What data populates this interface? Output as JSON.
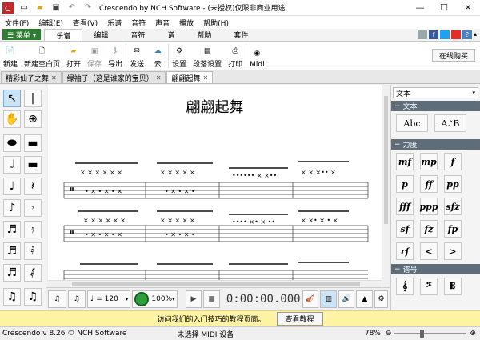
{
  "window": {
    "title": "Crescendo by NCH Software - (未授权)仅限非商业用途"
  },
  "menu": [
    "文件(F)",
    "编辑(E)",
    "查看(V)",
    "乐谱",
    "音符",
    "声音",
    "播放",
    "帮助(H)"
  ],
  "ribbon": {
    "main_button": "☰ 菜单 ▾",
    "tabs": [
      "乐谱",
      "编辑",
      "音符",
      "谱",
      "帮助",
      "套件"
    ]
  },
  "toolbar": {
    "new": "新建",
    "new_blank": "新建空白页",
    "open": "打开",
    "save": "保存",
    "export": "导出",
    "send": "发送",
    "cloud": "云",
    "settings": "设置",
    "staff_settings": "段落设置",
    "print": "打印",
    "midi": "Midi",
    "buy_online": "在线购买"
  },
  "doc_tabs": [
    "精彩仙子之舞",
    "绿袖子（这是谁家的宝贝）",
    "翩翩起舞"
  ],
  "score": {
    "title": "翩翩起舞"
  },
  "playback": {
    "tempo": "= 120",
    "volume": "100%",
    "time": "0:00:00.000"
  },
  "right_panel": {
    "selector": "文本",
    "sections": {
      "text": "文本",
      "dynamics": "力度",
      "clefs": "谱号"
    },
    "dynamics": [
      "mf",
      "mp",
      "f",
      "p",
      "ff",
      "pp",
      "fff",
      "ppp",
      "sfz",
      "sf",
      "fz",
      "fp",
      "rf"
    ]
  },
  "tip": {
    "text": "访问我们的入门技巧的教程页面。",
    "button": "查看教程"
  },
  "status": {
    "version": "Crescendo v 8.26 © NCH Software",
    "midi": "未选择 MIDI 设备",
    "zoom": "78%"
  },
  "colors": {
    "accent_green": "#2f7d32",
    "panel_header": "#5f6d7a",
    "tip_bg": "#fff3a6"
  }
}
